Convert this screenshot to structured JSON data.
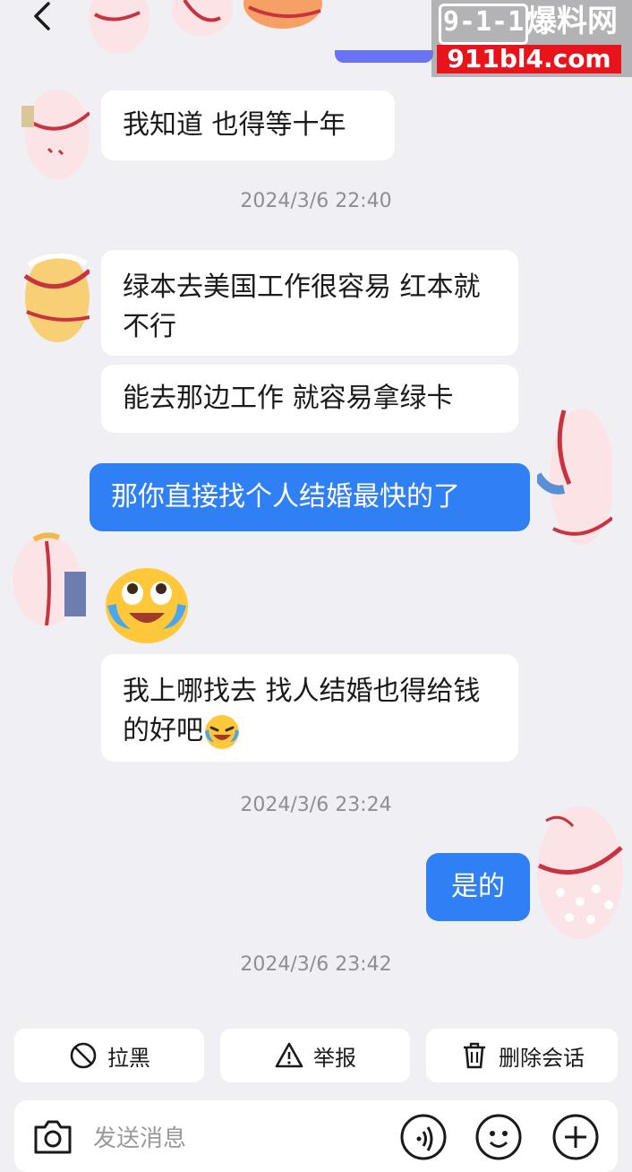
{
  "watermark": {
    "logo": "9-1-1",
    "title": "爆料网",
    "domain": "911bl4.com"
  },
  "messages": {
    "m1": "我知道 也得等十年",
    "m2": "绿本去美国工作很容易 红本就不行",
    "m3": "能去那边工作 就容易拿绿卡",
    "m4": "那你直接找个人结婚最快的了",
    "m6": "我上哪找去 找人结婚也得给钱的好吧",
    "m7": "是的"
  },
  "timestamps": [
    "2024/3/6 22:40",
    "2024/3/6 23:24",
    "2024/3/6 23:42"
  ],
  "actions": {
    "block": "拉黑",
    "report": "举报",
    "delete": "删除会话"
  },
  "composer": {
    "placeholder": "发送消息"
  },
  "icons": [
    "chevron-left-icon",
    "ban-icon",
    "warning-icon",
    "trash-icon",
    "camera-icon",
    "voice-icon",
    "emoji-icon",
    "plus-icon",
    "crying-laugh-emoji"
  ],
  "colors": {
    "background": "#efeff4",
    "my_bubble": "#2f7ff5",
    "their_bubble": "#ffffff",
    "watermark_red": "#e8141b",
    "accent": "#6b73f5"
  }
}
